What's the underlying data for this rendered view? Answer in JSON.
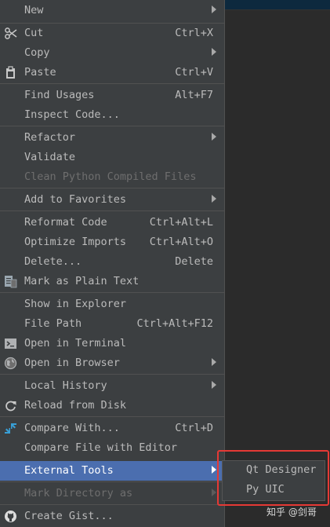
{
  "menu": {
    "items": [
      {
        "label": "New",
        "arrow": true
      },
      {
        "label": "Cut",
        "shortcut": "Ctrl+X",
        "icon": "scissors-icon"
      },
      {
        "label": "Copy",
        "arrow": true
      },
      {
        "label": "Paste",
        "shortcut": "Ctrl+V",
        "icon": "clipboard-icon"
      },
      {
        "label": "Find Usages",
        "shortcut": "Alt+F7"
      },
      {
        "label": "Inspect Code..."
      },
      {
        "label": "Refactor",
        "arrow": true
      },
      {
        "label": "Validate"
      },
      {
        "label": "Clean Python Compiled Files",
        "disabled": true
      },
      {
        "label": "Add to Favorites",
        "arrow": true
      },
      {
        "label": "Reformat Code",
        "shortcut": "Ctrl+Alt+L"
      },
      {
        "label": "Optimize Imports",
        "shortcut": "Ctrl+Alt+O"
      },
      {
        "label": "Delete...",
        "shortcut": "Delete"
      },
      {
        "label": "Mark as Plain Text",
        "icon": "plain-text-icon"
      },
      {
        "label": "Show in Explorer"
      },
      {
        "label": "File Path",
        "shortcut": "Ctrl+Alt+F12"
      },
      {
        "label": "Open in Terminal",
        "icon": "terminal-icon"
      },
      {
        "label": "Open in Browser",
        "arrow": true,
        "icon": "globe-icon"
      },
      {
        "label": "Local History",
        "arrow": true
      },
      {
        "label": "Reload from Disk",
        "icon": "reload-icon"
      },
      {
        "label": "Compare With...",
        "shortcut": "Ctrl+D",
        "icon": "compare-icon"
      },
      {
        "label": "Compare File with Editor"
      },
      {
        "label": "External Tools",
        "arrow": true,
        "selected": true
      },
      {
        "label": "Mark Directory as",
        "arrow": true,
        "disabled": true
      },
      {
        "label": "Create Gist...",
        "icon": "github-icon"
      }
    ]
  },
  "submenu": {
    "items": [
      {
        "label": "Qt Designer"
      },
      {
        "label": "Py UIC"
      }
    ]
  },
  "watermark": "知乎 @剑哥",
  "colors": {
    "menu_bg": "#3c3f41",
    "selected_bg": "#4b6eaf",
    "highlight_border": "#e53935",
    "text": "#bbbbbb",
    "disabled_text": "#6e6e6e"
  }
}
